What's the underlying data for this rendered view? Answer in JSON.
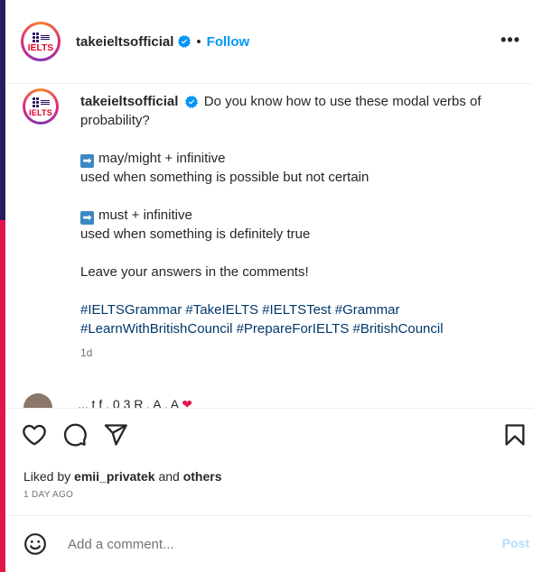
{
  "brand": {
    "avatar_alt": "British Council IELTS logo",
    "ielts": "IELTS",
    "colors": {
      "ring": "#dd2a7b",
      "ielts_red": "#e4002b",
      "verified_blue": "#0095f6",
      "link_blue": "#0095f6",
      "hashtag_blue": "#00376b"
    }
  },
  "header": {
    "username": "takeieltsofficial",
    "separator": "•",
    "follow_label": "Follow",
    "more_label": "•••"
  },
  "caption": {
    "username": "takeieltsofficial",
    "intro": "Do you know how to use these modal verbs of probability?",
    "point1_arrow": "➡",
    "point1_title": "may/might + infinitive",
    "point1_desc": "used when something is possible but not certain",
    "point2_arrow": "➡",
    "point2_title": "must + infinitive",
    "point2_desc": "used when something is definitely true",
    "cta": "Leave your answers in the comments!",
    "hashtags_line1": "#IELTSGrammar #TakeIELTS #IELTSTest #Grammar",
    "hashtags_line2": "#LearnWithBritishCouncil #PrepareForIELTS #BritishCouncil",
    "time": "1d"
  },
  "comment_peek": {
    "text": "... t f . 0 3   R . A . A",
    "heart": "❤"
  },
  "actions": {
    "like_icon": "heart-outline-icon",
    "comment_icon": "comment-bubble-icon",
    "share_icon": "paper-plane-icon",
    "save_icon": "bookmark-icon"
  },
  "likes": {
    "prefix": "Liked by",
    "user": "emii_privatek",
    "conj": "and",
    "others": "others",
    "ago": "1 DAY AGO"
  },
  "comment_box": {
    "placeholder": "Add a comment...",
    "post_label": "Post"
  }
}
